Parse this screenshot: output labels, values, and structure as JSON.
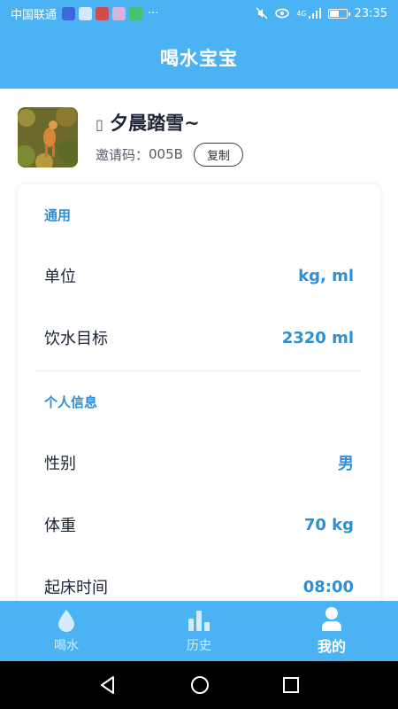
{
  "status_bar": {
    "carrier": "中国联通",
    "overflow": "···",
    "network": "4G",
    "time": "23:35",
    "battery_level_percent": 60
  },
  "app": {
    "title": "喝水宝宝"
  },
  "profile": {
    "nickname": "夕晨踏雪~",
    "nickname_prefix_glyph": "▯",
    "invite_label": "邀请码：",
    "invite_code": "005B",
    "copy_label": "复制"
  },
  "settings": {
    "general_title": "通用",
    "unit_label": "单位",
    "unit_value": "kg, ml",
    "goal_label": "饮水目标",
    "goal_value": "2320 ml",
    "personal_title": "个人信息",
    "gender_label": "性别",
    "gender_value": "男",
    "weight_label": "体重",
    "weight_value": "70 kg",
    "wake_label": "起床时间",
    "wake_value": "08:00"
  },
  "tabs": [
    {
      "label": "喝水",
      "icon": "water-drop-icon"
    },
    {
      "label": "历史",
      "icon": "bar-chart-icon"
    },
    {
      "label": "我的",
      "icon": "person-icon"
    }
  ],
  "colors": {
    "primary": "#4bb3f3",
    "accent_text": "#2d8fd5",
    "text_dark": "#1c2536"
  }
}
